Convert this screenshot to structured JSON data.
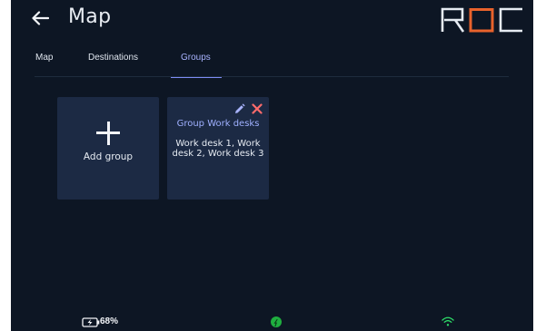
{
  "header": {
    "title": "Map",
    "logo_text": "ROC"
  },
  "tabs": [
    {
      "label": "Map",
      "active": false
    },
    {
      "label": "Destinations",
      "active": false
    },
    {
      "label": "Groups",
      "active": true
    }
  ],
  "cards": {
    "add": {
      "label": "Add group"
    },
    "groups": [
      {
        "title": "Group Work desks",
        "members": "Work desk 1, Work desk 2, Work desk 3"
      }
    ]
  },
  "status": {
    "battery": "68%"
  },
  "colors": {
    "background": "#0d1624",
    "card": "#1c2a44",
    "accent": "#7e8cf5",
    "logo_orange": "#e8622c",
    "delete_red": "#ff6b6b",
    "charge_green": "#1fae3f",
    "wifi_green": "#2ee06a"
  },
  "icons": [
    "back-arrow-icon",
    "plus-icon",
    "pencil-icon",
    "close-icon",
    "battery-charging-icon",
    "charging-status-icon",
    "wifi-icon"
  ]
}
